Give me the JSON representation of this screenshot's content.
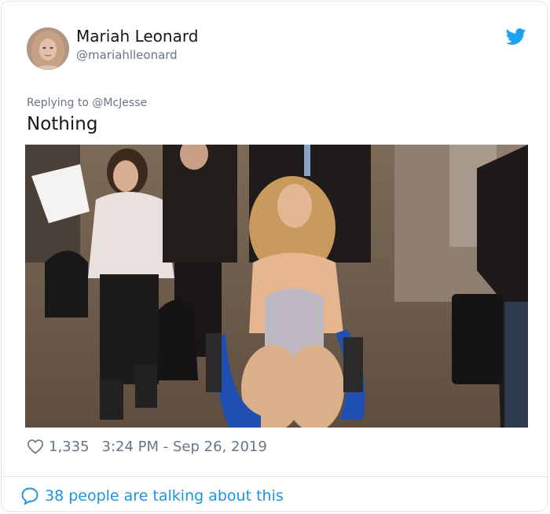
{
  "author": {
    "name": "Mariah Leonard",
    "handle": "@mariahlleonard"
  },
  "icons": {
    "brand": "twitter-bird-icon",
    "like": "heart-icon",
    "comment": "speech-bubble-icon"
  },
  "colors": {
    "brand": "#1da1f2",
    "link": "#1b95e0",
    "muted": "#657786",
    "text": "#14171a",
    "border": "#e1e8ed"
  },
  "tweet": {
    "replying_to": "Replying to @McJesse",
    "text": "Nothing"
  },
  "meta": {
    "likes": "1,335",
    "timestamp": "3:24 PM - Sep 26, 2019"
  },
  "footer": {
    "talking": "38 people are talking about this"
  }
}
